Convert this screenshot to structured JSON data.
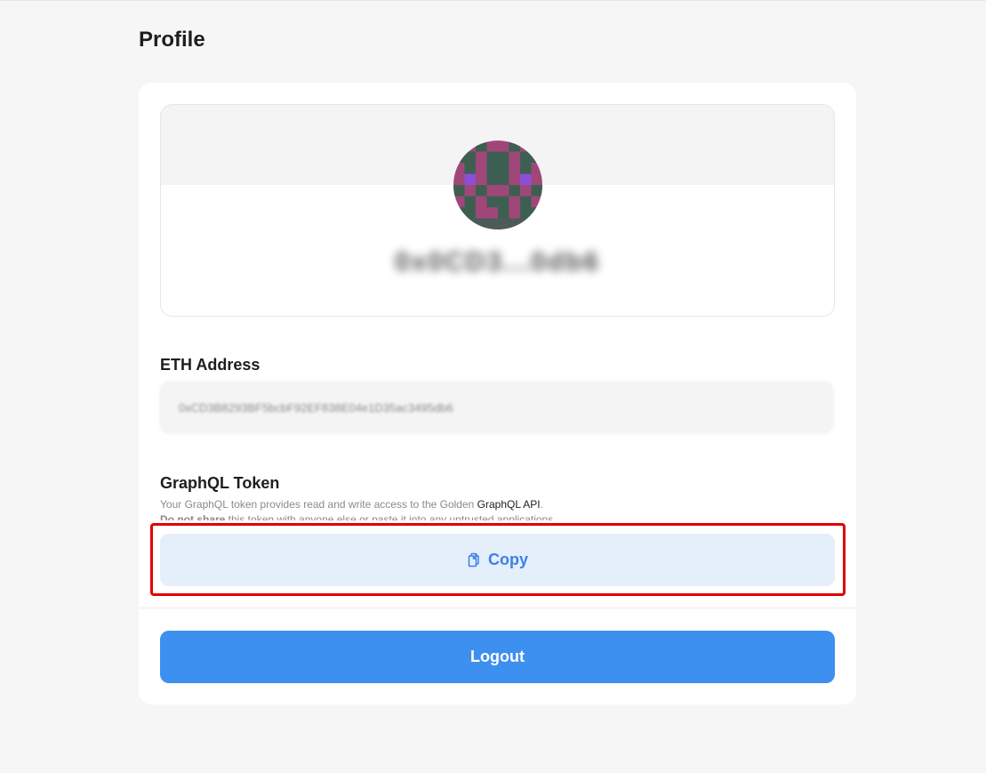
{
  "page": {
    "title": "Profile"
  },
  "profile": {
    "avatar_icon": "pixel-avatar",
    "username_blurred": "0x0CD3...0db6"
  },
  "eth": {
    "label": "ETH Address",
    "value_blurred": "0xCD3B8293BF5bcbF92EF838E04e1D35ac3495db6"
  },
  "graphql": {
    "label": "GraphQL Token",
    "desc_prefix": "Your GraphQL token provides read and write access to the Golden ",
    "desc_link": "GraphQL API",
    "desc_suffix": ".",
    "warn_bold": "Do not share",
    "warn_rest": " this token with anyone else or paste it into any untrusted applications."
  },
  "actions": {
    "copy_label": "Copy",
    "copy_icon": "clipboard-icon",
    "logout_label": "Logout"
  },
  "colors": {
    "accent": "#3d8ff0",
    "copy_bg": "#e5eefb",
    "copy_text": "#3b82e6",
    "highlight": "#e00000",
    "avatar_pink": "#a0477a",
    "avatar_green": "#3d5f52",
    "avatar_purple": "#8a4fd6"
  }
}
